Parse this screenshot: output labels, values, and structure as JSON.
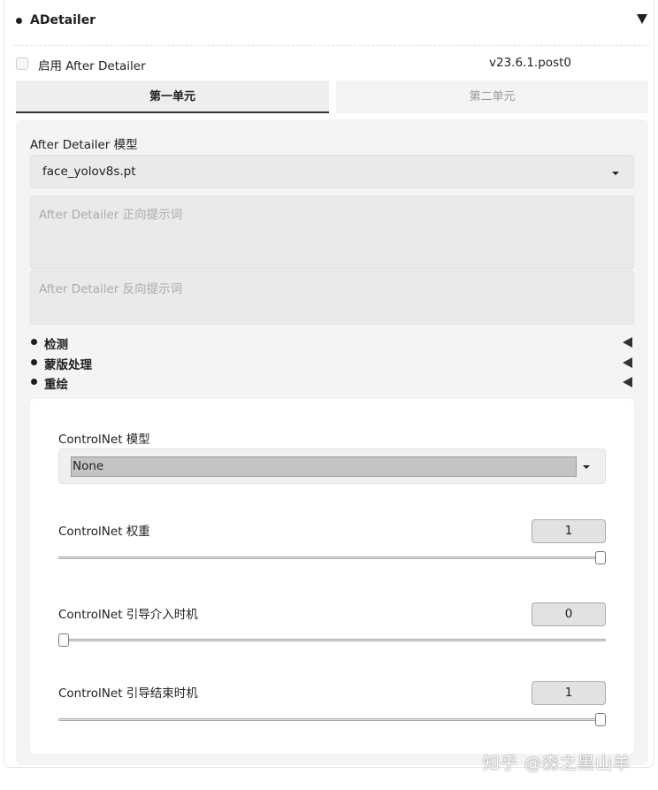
{
  "header": {
    "title": "ADetailer"
  },
  "enable": {
    "label": "启用 After Detailer",
    "checked": false,
    "version": "v23.6.1.post0"
  },
  "tabs": [
    {
      "label": "第一单元",
      "active": true
    },
    {
      "label": "第二单元",
      "active": false
    }
  ],
  "model": {
    "label": "After Detailer 模型",
    "value": "face_yolov8s.pt"
  },
  "prompts": {
    "positive_placeholder": "After Detailer 正向提示词",
    "negative_placeholder": "After Detailer 反向提示词"
  },
  "accordions": [
    {
      "label": "检测"
    },
    {
      "label": "蒙版处理"
    },
    {
      "label": "重绘"
    }
  ],
  "controlnet": {
    "model_label": "ControlNet 模型",
    "model_value": "None",
    "weight": {
      "label": "ControlNet 权重",
      "value": "1",
      "fraction": 1.0
    },
    "guidance_start": {
      "label": "ControlNet 引导介入时机",
      "value": "0",
      "fraction": 0.0
    },
    "guidance_end": {
      "label": "ControlNet 引导结束时机",
      "value": "1",
      "fraction": 1.0
    }
  },
  "watermark": "知乎 @森之黑山羊"
}
